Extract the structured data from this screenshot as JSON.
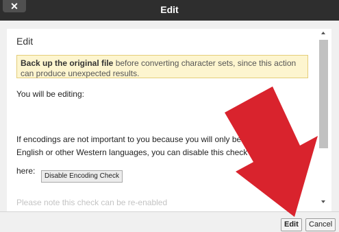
{
  "dialog": {
    "title": "Edit",
    "close_glyph": "✕"
  },
  "body": {
    "heading": "Edit",
    "notice_bold": "Back up the original file",
    "notice_rest": " before converting character sets, since this action can produce unexpected results.",
    "editing_label": "You will be editing:",
    "encodings_text": "If encodings are not important to you because you will only be working with English or other Western languages, you can disable this check",
    "here_label": "here:",
    "disable_button_label": "Disable Encoding Check",
    "cutoff_text": "Please note this check can be re-enabled"
  },
  "footer": {
    "edit_label": "Edit",
    "cancel_label": "Cancel"
  },
  "colors": {
    "titlebar": "#2e2e2e",
    "notice_bg": "#fdf5cf",
    "annotation_arrow": "#d9232d"
  }
}
